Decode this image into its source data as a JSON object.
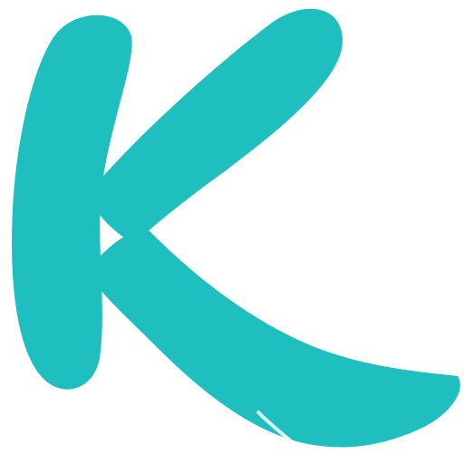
{
  "logo": {
    "icon": "letter-k-icon",
    "lettering": "K",
    "color": "#1FBFBF",
    "background": "#FFFFFF"
  }
}
